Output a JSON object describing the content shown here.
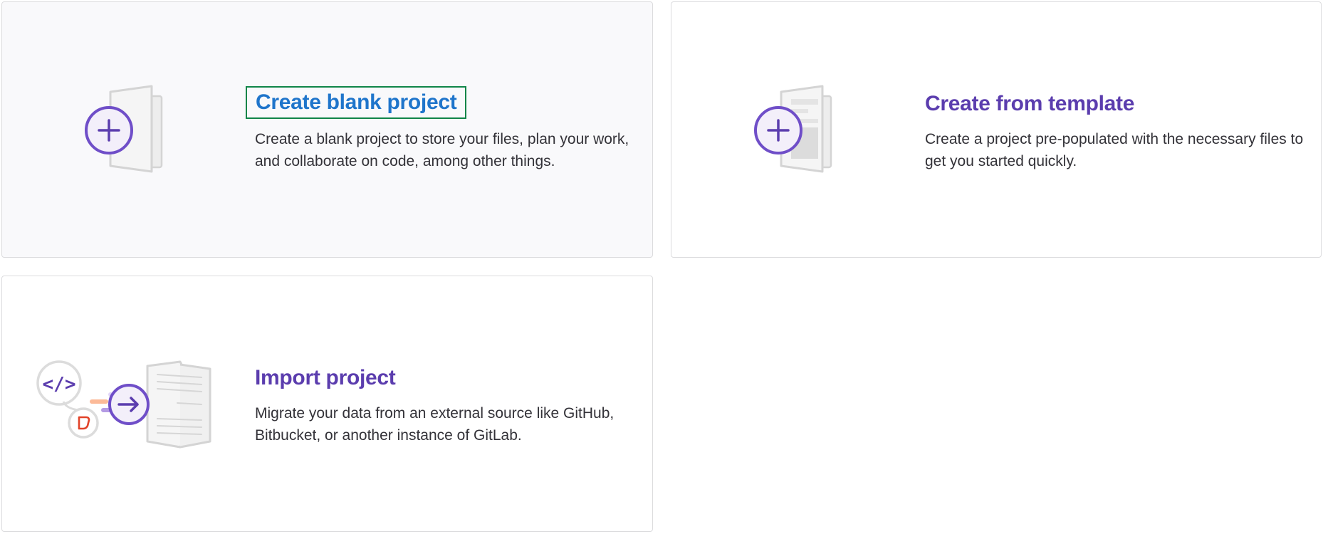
{
  "colors": {
    "accent_purple": "#5b3dae",
    "focus_blue": "#1f75cb",
    "focus_outline_green": "#108548",
    "border_gray": "#dcdcde",
    "text_dark": "#333238",
    "illustration_orange": "#e24329",
    "illustration_orange_light": "#fcba98"
  },
  "cards": [
    {
      "title": "Create blank project",
      "description": "Create a blank project to store your files, plan your work, and collaborate on code, among other things.",
      "icon": "plus-document-icon",
      "state": "focused"
    },
    {
      "title": "Create from template",
      "description": "Create a project pre-populated with the necessary files to get you started quickly.",
      "icon": "plus-template-icon"
    },
    {
      "title": "Import project",
      "description": "Migrate your data from an external source like GitHub, Bitbucket, or another instance of GitLab.",
      "icon": "import-arrow-icon"
    }
  ]
}
